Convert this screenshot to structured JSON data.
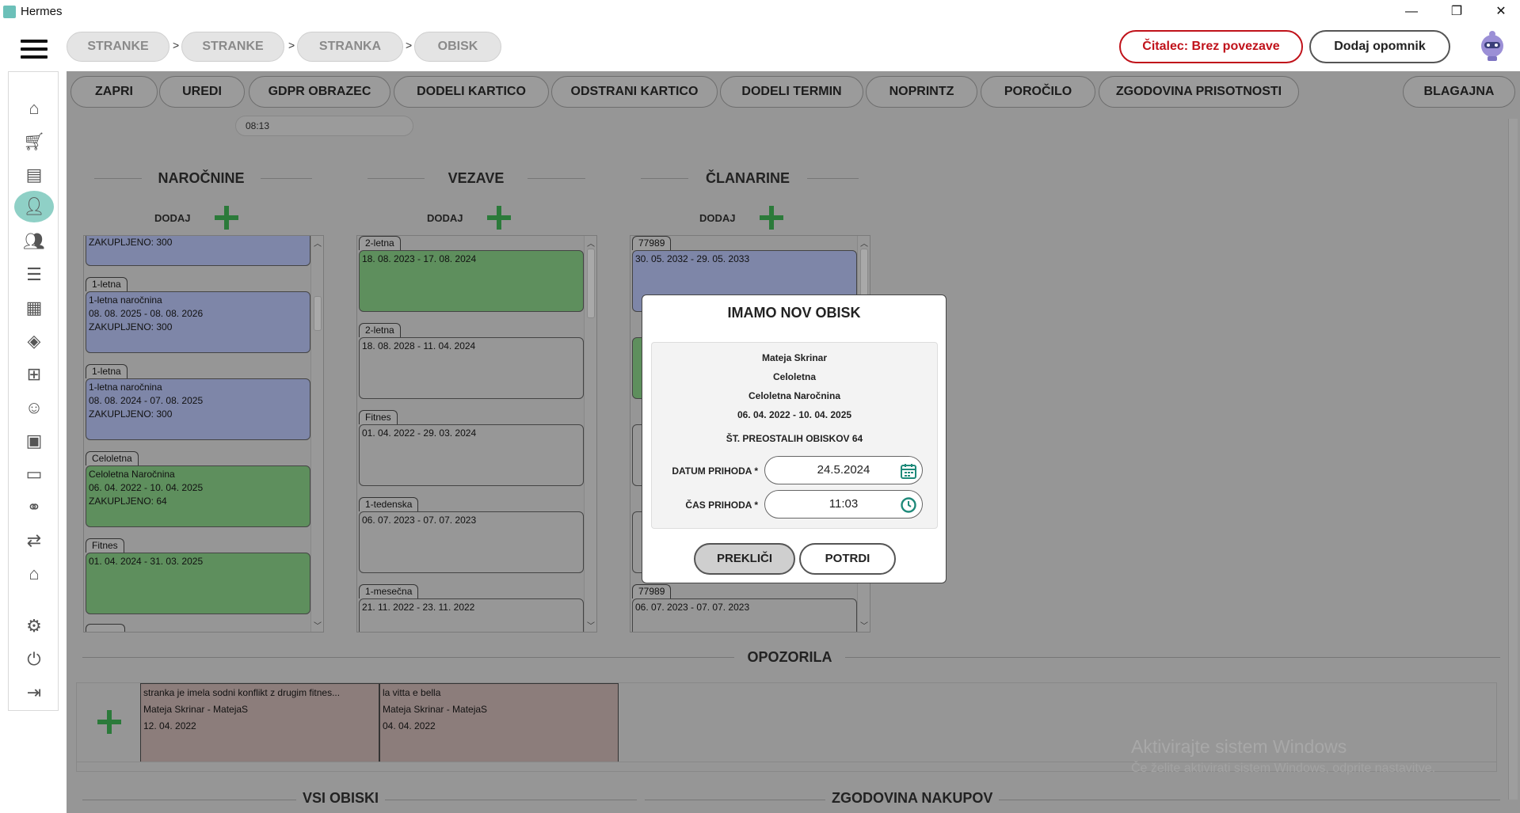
{
  "window": {
    "title": "Hermes",
    "minimize": "—",
    "restore": "❐",
    "close": "✕"
  },
  "breadcrumb": {
    "items": [
      "STRANKE",
      "STRANKE",
      "STRANKA",
      "OBISK"
    ],
    "separator": ">"
  },
  "header": {
    "reader_status": "Čitalec: Brez povezave",
    "reader_status_color": "#c0121a",
    "add_reminder": "Dodaj opomnik"
  },
  "sidebar": {
    "icons": [
      "home-icon",
      "cart-icon",
      "document-icon",
      "user-icon",
      "users-icon",
      "list-icon",
      "calendar-icon",
      "layers-icon",
      "network-icon",
      "employee-icon",
      "briefcase-icon",
      "chat-icon",
      "handshake-icon",
      "transfer-icon",
      "house-icon",
      "gear-icon",
      "power-icon",
      "logout-icon"
    ],
    "active": "user-icon"
  },
  "toolbar": {
    "buttons": [
      "ZAPRI",
      "UREDI",
      "GDPR OBRAZEC",
      "DODELI KARTICO",
      "ODSTRANI KARTICO",
      "DODELI TERMIN",
      "NOPRINTZ",
      "POROČILO",
      "ZGODOVINA PRISOTNOSTI"
    ],
    "right_button": "BLAGAJNA"
  },
  "time_value": "08:13",
  "sections": {
    "narocnine": "NAROČNINE",
    "vezave": "VEZAVE",
    "clanarine": "ČLANARINE",
    "add_label": "DODAJ"
  },
  "narocnine_cards": [
    {
      "tag": "",
      "lines": [
        "ZAKUPLJENO: 300"
      ],
      "color": "blue"
    },
    {
      "tag": "1-letna",
      "lines": [
        "1-letna naročnina",
        "08. 08. 2025 - 08. 08. 2026",
        "ZAKUPLJENO: 300"
      ],
      "color": "blue"
    },
    {
      "tag": "1-letna",
      "lines": [
        "1-letna naročnina",
        "08. 08. 2024 - 07. 08. 2025",
        "ZAKUPLJENO: 300"
      ],
      "color": "blue"
    },
    {
      "tag": "Celoletna",
      "lines": [
        "Celoletna Naročnina",
        "06. 04. 2022 - 10. 04. 2025",
        "ZAKUPLJENO: 64"
      ],
      "color": "green"
    },
    {
      "tag": "Fitnes",
      "lines": [
        "01. 04. 2024 - 31. 03. 2025"
      ],
      "color": "green"
    }
  ],
  "vezave_cards": [
    {
      "tag": "2-letna",
      "lines": [
        "18. 08. 2023 - 17. 08. 2024"
      ],
      "color": "green"
    },
    {
      "tag": "2-letna",
      "lines": [
        "18. 08. 2028 - 11. 04. 2024"
      ],
      "color": "gray"
    },
    {
      "tag": "Fitnes",
      "lines": [
        "01. 04. 2022 - 29. 03. 2024"
      ],
      "color": "gray"
    },
    {
      "tag": "1-tedenska",
      "lines": [
        "06. 07. 2023 - 07. 07. 2023"
      ],
      "color": "gray"
    },
    {
      "tag": "1-mesečna",
      "lines": [
        "21. 11. 2022 - 23. 11. 2022"
      ],
      "color": "gray"
    }
  ],
  "clanarine_cards": [
    {
      "tag": "77989",
      "lines": [
        "30. 05. 2032 - 29. 05. 2033"
      ],
      "color": "blue"
    },
    {
      "tag": "77989",
      "lines": [
        "06. 07. 2023 - 07. 07. 2023"
      ],
      "color": "gray"
    }
  ],
  "opozorila": {
    "title": "OPOZORILA",
    "warnings": [
      {
        "lines": [
          "stranka je imela sodni konflikt z drugim fitnes...",
          "Mateja Skrinar - MatejaS",
          "12. 04. 2022"
        ]
      },
      {
        "lines": [
          "la vitta e bella",
          "Mateja Skrinar - MatejaS",
          "04. 04. 2022"
        ]
      }
    ]
  },
  "bottom_sections": {
    "left": "VSI OBISKI",
    "right": "ZGODOVINA NAKUPOV"
  },
  "watermark": {
    "line1": "Aktivirajte sistem Windows",
    "line2": "Če želite aktivirati sistem Windows, odprite nastavitve."
  },
  "dialog": {
    "title": "IMAMO NOV OBISK",
    "name": "Mateja Skrinar",
    "membership": "Celoletna",
    "subscription": "Celoletna Naročnina",
    "period": "06. 04. 2022 - 10. 04. 2025",
    "remaining": "ŠT. PREOSTALIH OBISKOV 64",
    "date_label": "DATUM PRIHODA *",
    "date_value": "24.5.2024",
    "time_label": "ČAS PRIHODA *",
    "time_value": "11:03",
    "cancel": "PREKLIČI",
    "confirm": "POTRDI",
    "accent": "#1f8a7a"
  }
}
